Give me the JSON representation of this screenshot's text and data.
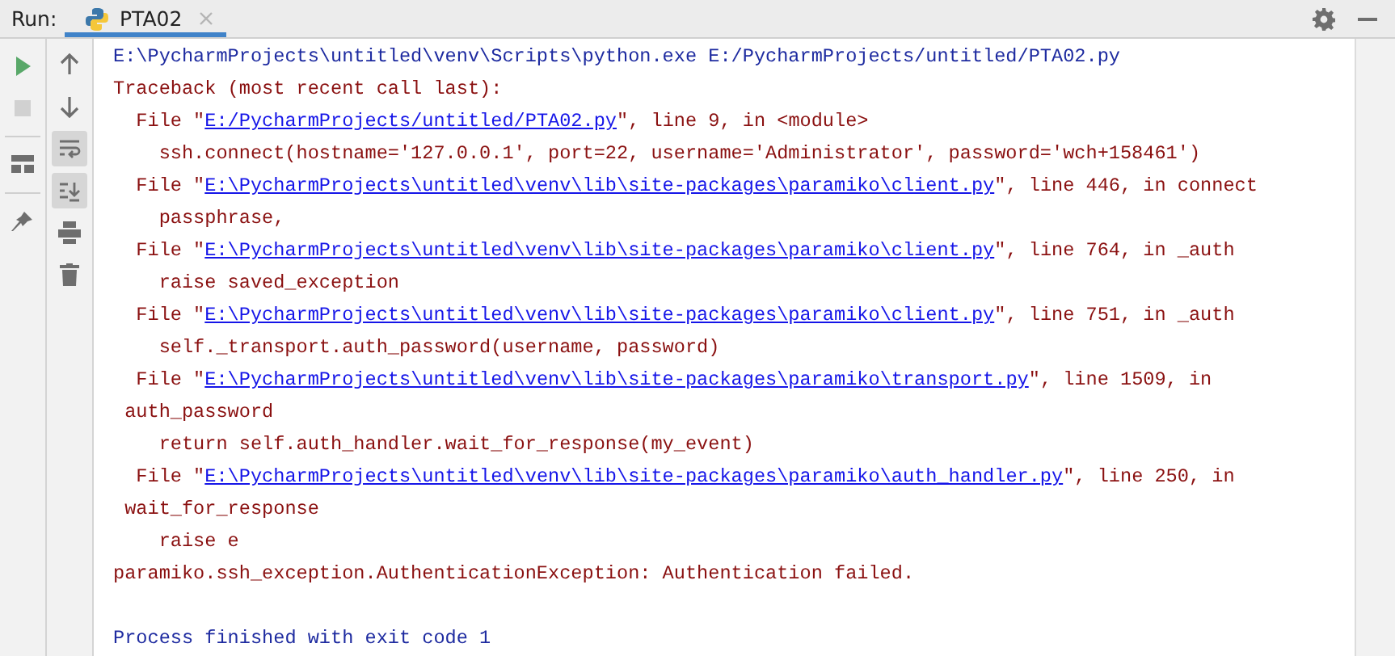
{
  "header": {
    "run_label": "Run:",
    "tabs": [
      {
        "label": "PTA02",
        "selected": true
      }
    ]
  },
  "left_toolbar": [
    {
      "kind": "run",
      "disabled": false
    },
    {
      "kind": "stop",
      "disabled": true
    },
    {
      "kind": "layout",
      "disabled": false
    },
    {
      "kind": "pin",
      "disabled": false
    }
  ],
  "console_toolbar": [
    {
      "kind": "up",
      "on": false
    },
    {
      "kind": "down",
      "on": false
    },
    {
      "kind": "wrap",
      "on": true
    },
    {
      "kind": "scroll_end",
      "on": true
    },
    {
      "kind": "print",
      "on": false
    },
    {
      "kind": "trash",
      "on": false
    }
  ],
  "console": [
    {
      "kind": "command",
      "text": "E:\\PycharmProjects\\untitled\\venv\\Scripts\\python.exe E:/PycharmProjects/untitled/PTA02.py"
    },
    {
      "kind": "traceback",
      "text": "Traceback (most recent call last):"
    },
    {
      "kind": "file",
      "prefix": "File \"",
      "link": "E:/PycharmProjects/untitled/PTA02.py",
      "suffix": "\", line 9, in <module>"
    },
    {
      "kind": "code",
      "text": "ssh.connect(hostname='127.0.0.1', port=22, username='Administrator', password='wch+158461')"
    },
    {
      "kind": "file",
      "prefix": "File \"",
      "link": "E:\\PycharmProjects\\untitled\\venv\\lib\\site-packages\\paramiko\\client.py",
      "suffix": "\", line 446, in connect"
    },
    {
      "kind": "code",
      "text": "passphrase,"
    },
    {
      "kind": "file",
      "prefix": "File \"",
      "link": "E:\\PycharmProjects\\untitled\\venv\\lib\\site-packages\\paramiko\\client.py",
      "suffix": "\", line 764, in _auth"
    },
    {
      "kind": "code",
      "text": "raise saved_exception"
    },
    {
      "kind": "file",
      "prefix": "File \"",
      "link": "E:\\PycharmProjects\\untitled\\venv\\lib\\site-packages\\paramiko\\client.py",
      "suffix": "\", line 751, in _auth"
    },
    {
      "kind": "code",
      "text": "self._transport.auth_password(username, password)"
    },
    {
      "kind": "file",
      "prefix": "File \"",
      "link": "E:\\PycharmProjects\\untitled\\venv\\lib\\site-packages\\paramiko\\transport.py",
      "suffix": "\", line 1509, in"
    },
    {
      "kind": "continuation",
      "text": "auth_password"
    },
    {
      "kind": "code",
      "text": "return self.auth_handler.wait_for_response(my_event)"
    },
    {
      "kind": "file",
      "prefix": "File \"",
      "link": "E:\\PycharmProjects\\untitled\\venv\\lib\\site-packages\\paramiko\\auth_handler.py",
      "suffix": "\", line 250, in"
    },
    {
      "kind": "continuation",
      "text": "wait_for_response"
    },
    {
      "kind": "code",
      "text": "raise e"
    },
    {
      "kind": "exception",
      "text": "paramiko.ssh_exception.AuthenticationException: Authentication failed."
    },
    {
      "kind": "blank"
    },
    {
      "kind": "exit",
      "text": "Process finished with exit code 1"
    }
  ]
}
